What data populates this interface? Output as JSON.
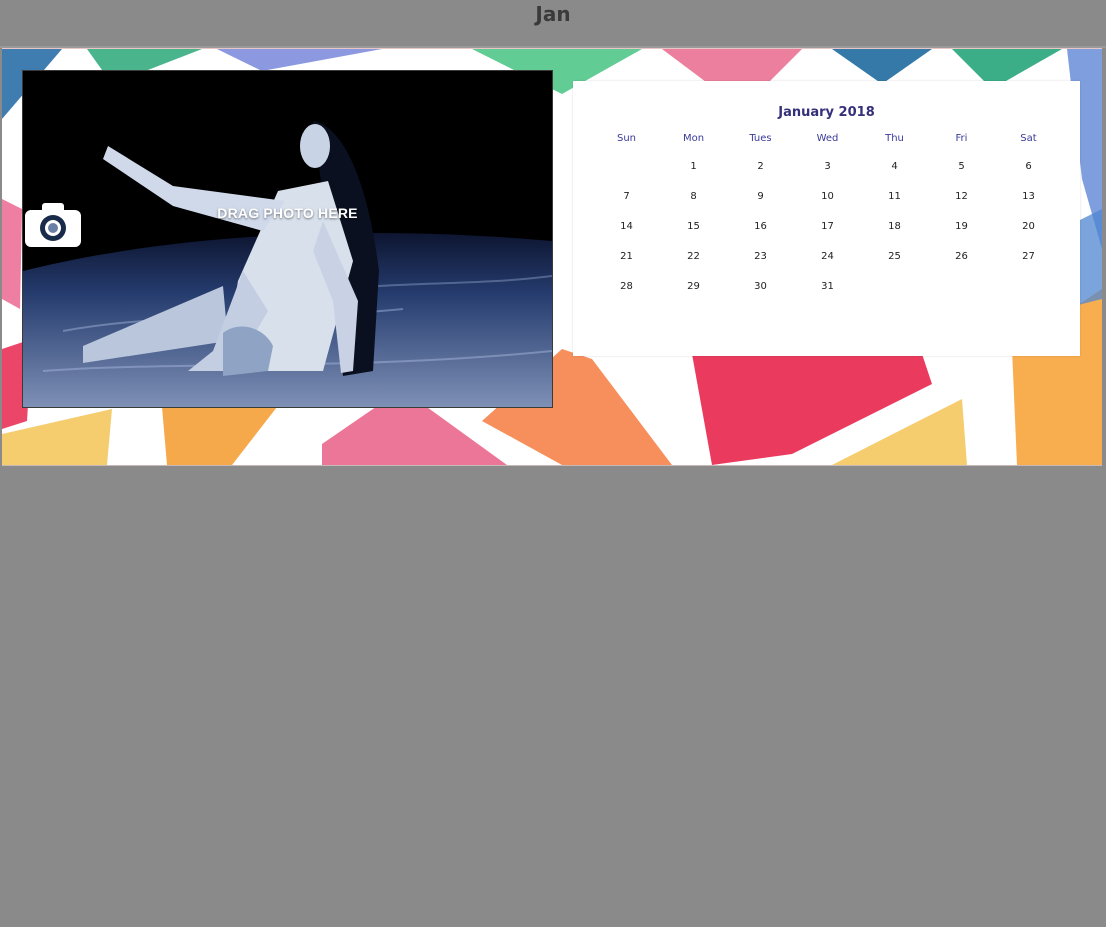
{
  "header": {
    "title": "Jan"
  },
  "photo_placeholder": {
    "label": "DRAG PHOTO HERE",
    "icon": "camera-icon"
  },
  "calendar": {
    "title": "January 2018",
    "weekdays": [
      "Sun",
      "Mon",
      "Tues",
      "Wed",
      "Thu",
      "Fri",
      "Sat"
    ],
    "weeks": [
      [
        "",
        "1",
        "2",
        "3",
        "4",
        "5",
        "6"
      ],
      [
        "7",
        "8",
        "9",
        "10",
        "11",
        "12",
        "13"
      ],
      [
        "14",
        "15",
        "16",
        "17",
        "18",
        "19",
        "20"
      ],
      [
        "21",
        "22",
        "23",
        "24",
        "25",
        "26",
        "27"
      ],
      [
        "28",
        "29",
        "30",
        "31",
        "",
        "",
        ""
      ]
    ]
  },
  "colors": {
    "canvas_bg": "#8a8a8a",
    "title_text": "#3a3a3a",
    "calendar_title": "#35307a",
    "weekday_text": "#3a3a9a"
  }
}
